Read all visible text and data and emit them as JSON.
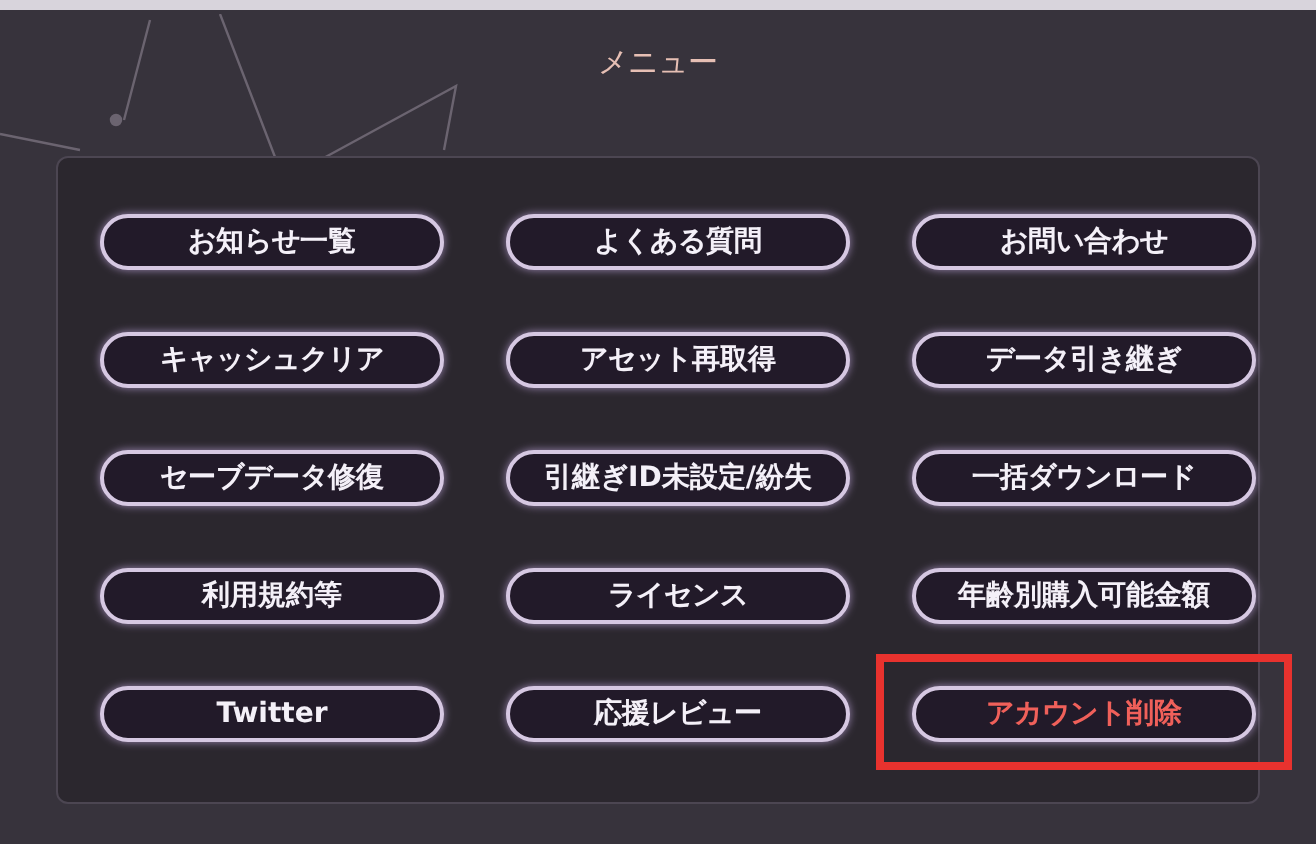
{
  "title": "メニュー",
  "buttons": [
    {
      "label": "お知らせ一覧",
      "highlighted": false
    },
    {
      "label": "よくある質問",
      "highlighted": false
    },
    {
      "label": "お問い合わせ",
      "highlighted": false
    },
    {
      "label": "キャッシュクリア",
      "highlighted": false
    },
    {
      "label": "アセット再取得",
      "highlighted": false
    },
    {
      "label": "データ引き継ぎ",
      "highlighted": false
    },
    {
      "label": "セーブデータ修復",
      "highlighted": false
    },
    {
      "label": "引継ぎID未設定/紛失",
      "highlighted": false
    },
    {
      "label": "一括ダウンロード",
      "highlighted": false
    },
    {
      "label": "利用規約等",
      "highlighted": false
    },
    {
      "label": "ライセンス",
      "highlighted": false
    },
    {
      "label": "年齢別購入可能金額",
      "highlighted": false
    },
    {
      "label": "Twitter",
      "highlighted": false
    },
    {
      "label": "応援レビュー",
      "highlighted": false
    },
    {
      "label": "アカウント削除",
      "highlighted": true
    }
  ]
}
